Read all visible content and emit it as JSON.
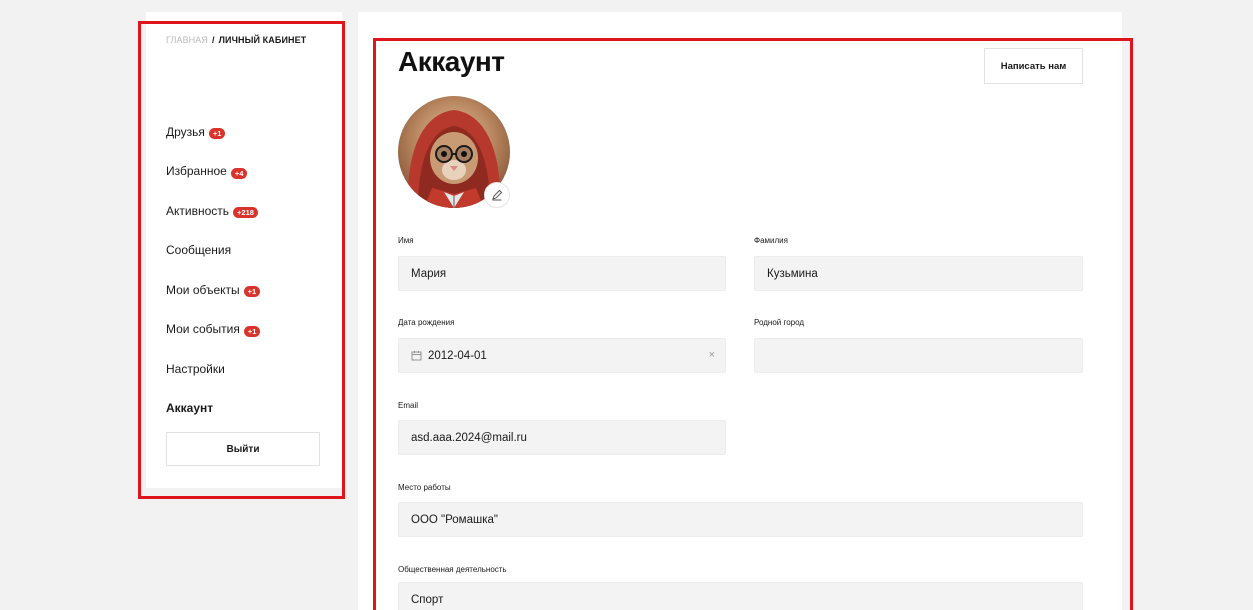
{
  "breadcrumb": {
    "home": "ГЛАВНАЯ",
    "separator": "/",
    "current": "ЛИЧНЫЙ КАБИНЕТ"
  },
  "sidebar": {
    "items": [
      {
        "label": "Друзья",
        "badge": "+1"
      },
      {
        "label": "Избранное",
        "badge": "+4"
      },
      {
        "label": "Активность",
        "badge": "+218"
      },
      {
        "label": "Сообщения",
        "badge": ""
      },
      {
        "label": "Мои объекты",
        "badge": "+1"
      },
      {
        "label": "Мои события",
        "badge": "+1"
      },
      {
        "label": "Настройки",
        "badge": ""
      },
      {
        "label": "Аккаунт",
        "badge": "",
        "active": true
      }
    ],
    "logout_label": "Выйти"
  },
  "main": {
    "title": "Аккаунт",
    "contact_label": "Написать нам",
    "avatar_icon": "edit-pencil-icon",
    "fields": {
      "first_name": {
        "label": "Имя",
        "value": "Мария"
      },
      "last_name": {
        "label": "Фамилия",
        "value": "Кузьмина"
      },
      "birth_date": {
        "label": "Дата рождения",
        "value": "2012-04-01",
        "clear_icon": "×"
      },
      "home_city": {
        "label": "Родной город",
        "value": ""
      },
      "email": {
        "label": "Email",
        "value": "asd.aaa.2024@mail.ru"
      },
      "workplace": {
        "label": "Место работы",
        "value": "ООО \"Ромашка\""
      },
      "social_activity": {
        "label": "Общественная деятельность",
        "value": "Спорт"
      }
    }
  },
  "colors": {
    "accent_badge": "#d9332b",
    "highlight_outline": "#e0141b",
    "field_bg": "#f3f3f3",
    "page_bg": "#f2f2f2"
  }
}
